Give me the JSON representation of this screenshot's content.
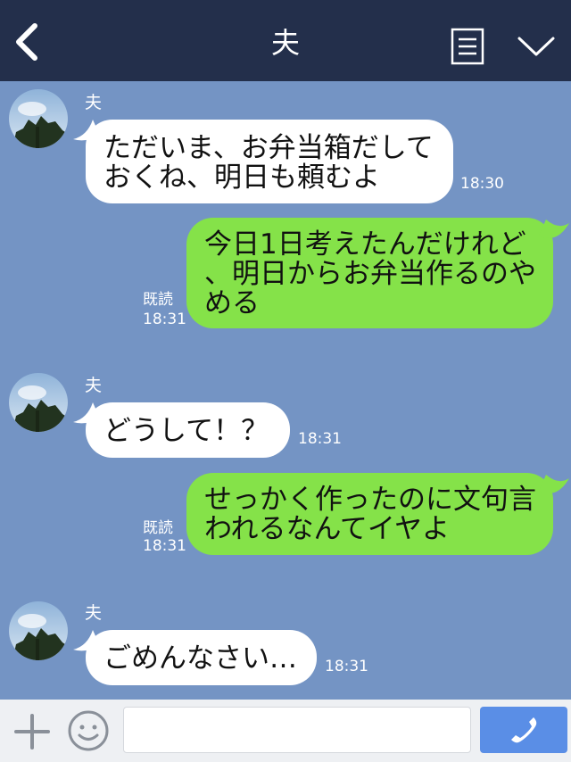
{
  "header": {
    "title": "夫",
    "icons": [
      "back-chevron-icon",
      "menu-list-icon",
      "collapse-chevron-icon"
    ],
    "background": "#232f4b"
  },
  "chat": {
    "background": "#7494c4",
    "incoming_bubble_color": "#ffffff",
    "outgoing_bubble_color": "#85e249",
    "messages": [
      {
        "direction": "in",
        "sender": "夫",
        "text": "ただいま、お弁当箱だして\nおくね、明日も頼むよ",
        "time": "18:30"
      },
      {
        "direction": "out",
        "text": "今日1日考えたんだけれど\n、明日からお弁当作るのや\nめる",
        "read": "既読",
        "time": "18:31"
      },
      {
        "direction": "in",
        "sender": "夫",
        "text": "どうして！？",
        "time": "18:31"
      },
      {
        "direction": "out",
        "text": "せっかく作ったのに文句言\nわれるなんてイヤよ",
        "read": "既読",
        "time": "18:31"
      },
      {
        "direction": "in",
        "sender": "夫",
        "text": "ごめんなさい…",
        "time": "18:31"
      }
    ]
  },
  "input_bar": {
    "icons": [
      "plus-icon",
      "smiley-icon",
      "phone-icon"
    ],
    "text_value": "",
    "call_button_color": "#5a8ee6"
  }
}
